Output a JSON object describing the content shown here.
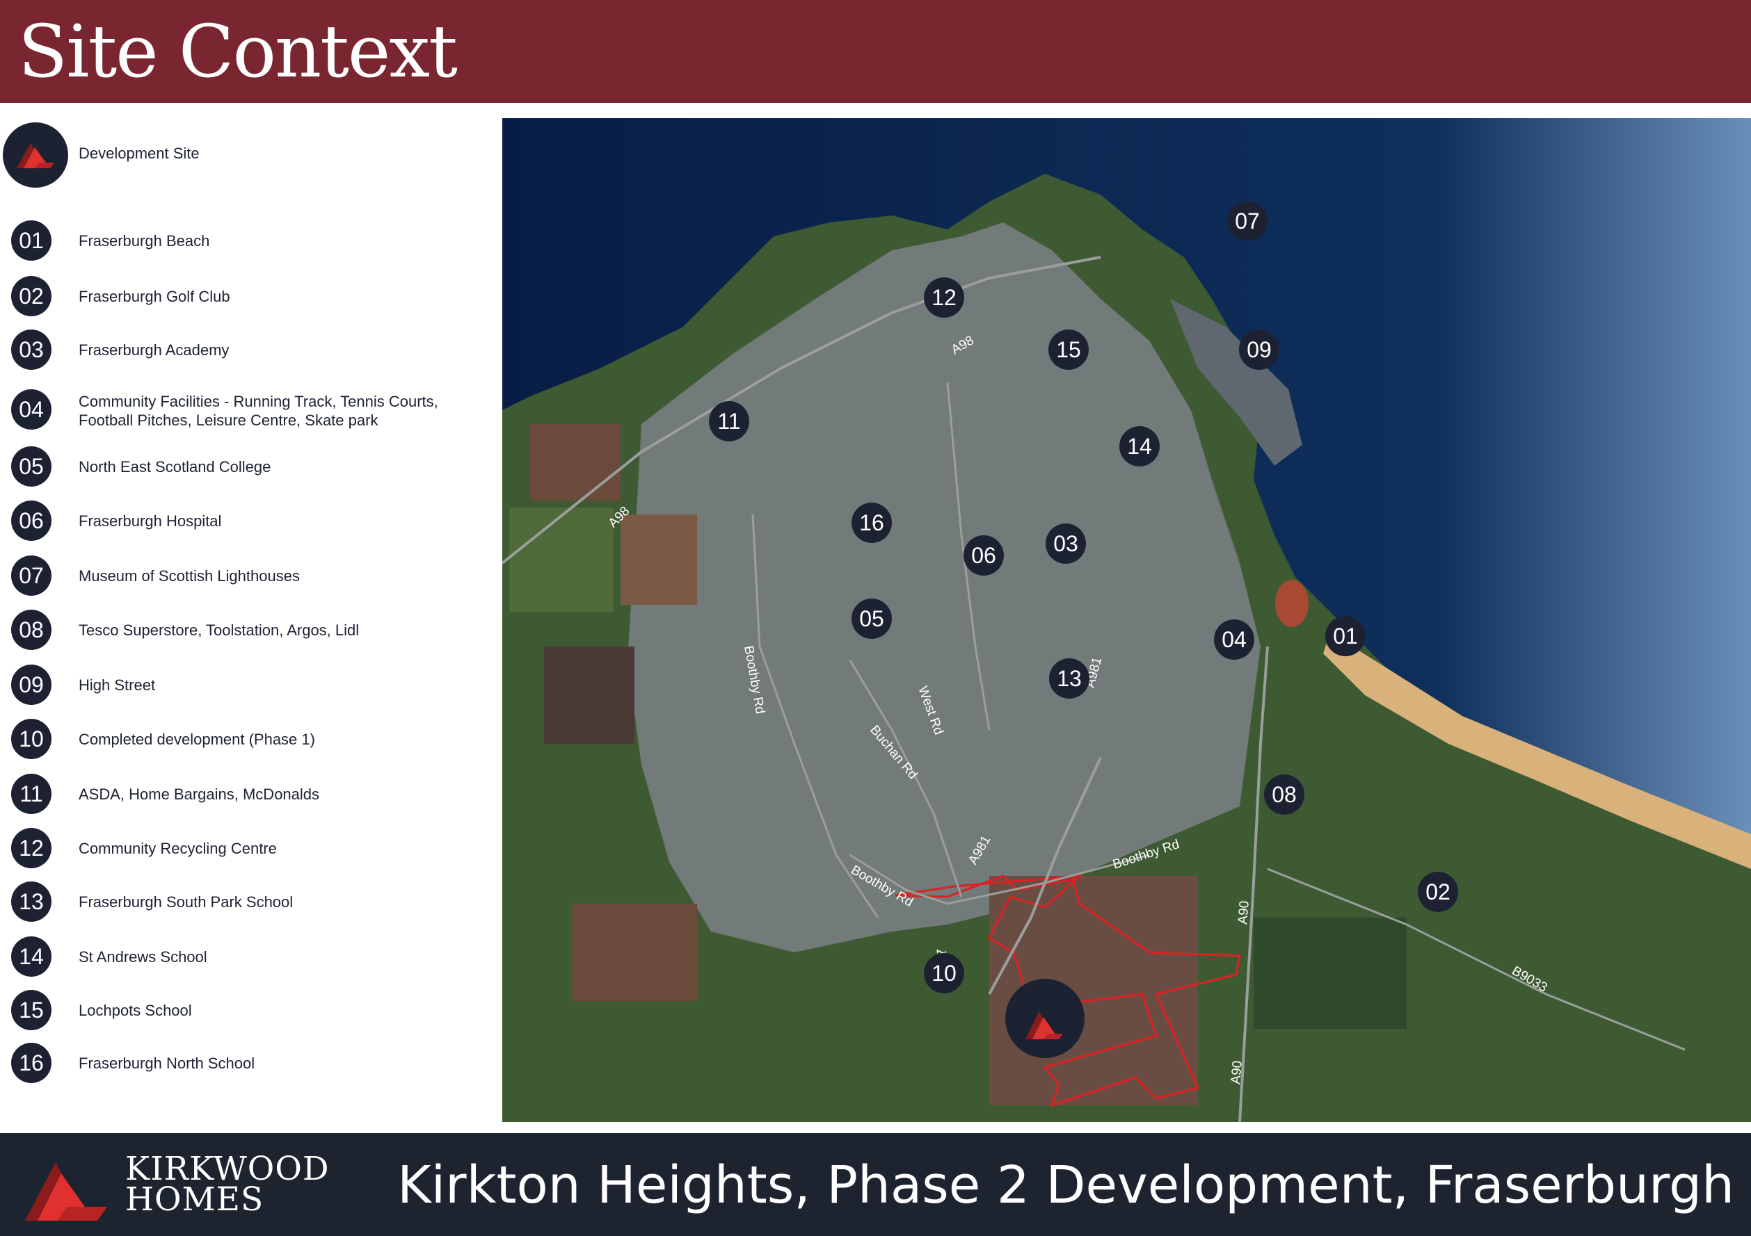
{
  "header": {
    "title": "Site Context"
  },
  "legend": {
    "development_site_label": "Development Site",
    "items": [
      {
        "num": "01",
        "label": "Fraserburgh Beach"
      },
      {
        "num": "02",
        "label": "Fraserburgh Golf Club"
      },
      {
        "num": "03",
        "label": "Fraserburgh Academy"
      },
      {
        "num": "04",
        "label": "Community Facilities - Running Track, Tennis Courts, Football Pitches, Leisure Centre, Skate park"
      },
      {
        "num": "05",
        "label": "North East Scotland College"
      },
      {
        "num": "06",
        "label": "Fraserburgh Hospital"
      },
      {
        "num": "07",
        "label": "Museum of Scottish Lighthouses"
      },
      {
        "num": "08",
        "label": "Tesco Superstore, Toolstation, Argos, Lidl"
      },
      {
        "num": "09",
        "label": "High Street"
      },
      {
        "num": "10",
        "label": "Completed development (Phase 1)"
      },
      {
        "num": "11",
        "label": "ASDA, Home Bargains, McDonalds"
      },
      {
        "num": "12",
        "label": "Community Recycling Centre"
      },
      {
        "num": "13",
        "label": "Fraserburgh South Park School"
      },
      {
        "num": "14",
        "label": "St Andrews School"
      },
      {
        "num": "15",
        "label": "Lochpots School"
      },
      {
        "num": "16",
        "label": "Fraserburgh North School"
      }
    ]
  },
  "map": {
    "road_labels": [
      "A98",
      "A98",
      "Boothby Rd",
      "West Rd",
      "Buchan Rd",
      "A981",
      "Boothby Rd",
      "A981",
      "Boothby Rd",
      "A981",
      "A90",
      "A90",
      "B9033"
    ],
    "markers": [
      "07",
      "12",
      "15",
      "09",
      "11",
      "14",
      "16",
      "06",
      "03",
      "05",
      "04",
      "01",
      "13",
      "08",
      "02",
      "10"
    ]
  },
  "footer": {
    "brand_line1": "KIRKWOOD",
    "brand_line2": "HOMES",
    "title": "Kirkton Heights, Phase 2 Development, Fraserburgh"
  },
  "colors": {
    "header_bg": "#7a2630",
    "footer_bg": "#1e2330",
    "badge_bg": "#1d2233",
    "brand_red": "#d42a2a",
    "site_boundary": "#e02020",
    "sea": "#0f2a55",
    "land": "#3d5a35"
  }
}
